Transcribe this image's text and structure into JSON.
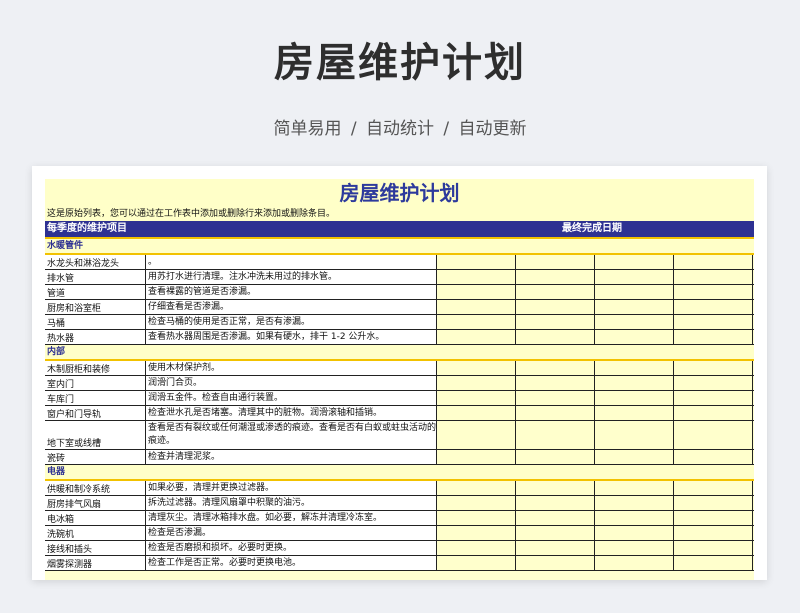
{
  "page": {
    "title": "房屋维护计划",
    "subtitle": "简单易用  /  自动统计  /  自动更新"
  },
  "sheet": {
    "title": "房屋维护计划",
    "note": "这是原始列表，您可以通过在工作表中添加或删除行来添加或删除条目。",
    "headers": {
      "item": "每季度的维护项目",
      "date": "最终完成日期"
    },
    "sections": [
      {
        "name": "水暖管件",
        "rows": [
          {
            "item": "水龙头和淋浴龙头",
            "desc": "。"
          },
          {
            "item": "排水管",
            "desc": "用苏打水进行清理。注水冲洗未用过的排水管。"
          },
          {
            "item": "管道",
            "desc": "查看裸露的管道是否渗漏。"
          },
          {
            "item": "厨房和浴室柜",
            "desc": "仔细查看是否渗漏。"
          },
          {
            "item": "马桶",
            "desc": "检查马桶的使用是否正常，是否有渗漏。"
          },
          {
            "item": "热水器",
            "desc": "查看热水器周围是否渗漏。如果有硬水，排干 1-2 公升水。"
          }
        ]
      },
      {
        "name": "内部",
        "rows": [
          {
            "item": "木制厨柜和装修",
            "desc": "使用木材保护剂。"
          },
          {
            "item": "室内门",
            "desc": "润滑门合页。"
          },
          {
            "item": "车库门",
            "desc": "润滑五金件。检查自由通行装置。"
          },
          {
            "item": "窗户和门导轨",
            "desc": "检查泄水孔是否堵塞。清理其中的脏物。润滑滚轴和插销。"
          },
          {
            "item": "地下室或线槽",
            "desc": "查看是否有裂纹或任何潮湿或渗透的痕迹。查看是否有白蚁或蛀虫活动的痕迹。",
            "tall": true
          },
          {
            "item": "瓷砖",
            "desc": "检查并清理泥浆。"
          }
        ]
      },
      {
        "name": "电器",
        "rows": [
          {
            "item": "供暖和制冷系统",
            "desc": "如果必要，清理并更换过滤器。"
          },
          {
            "item": "厨房排气风扇",
            "desc": "拆洗过滤器。清理风扇罩中积聚的油污。"
          },
          {
            "item": "电冰箱",
            "desc": "清理灰尘。清理冰箱排水盘。如必要，解冻并清理冷冻室。"
          },
          {
            "item": "洗碗机",
            "desc": "检查是否渗漏。"
          },
          {
            "item": "接线和插头",
            "desc": "检查是否磨损和损坏。必要时更换。"
          },
          {
            "item": "烟雾探测器",
            "desc": "检查工作是否正常。必要时更换电池。"
          }
        ]
      }
    ]
  }
}
